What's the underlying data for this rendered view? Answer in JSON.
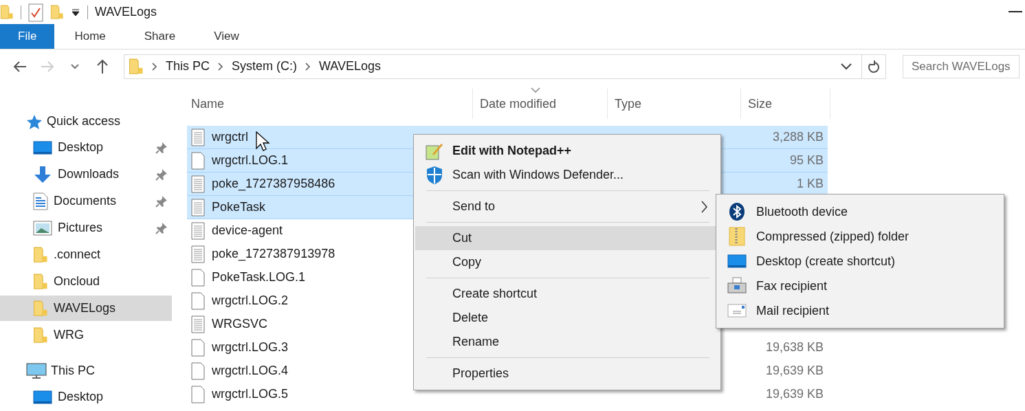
{
  "window": {
    "title": "WAVELogs"
  },
  "ribbon_tabs": [
    {
      "label": "File",
      "selected": true
    },
    {
      "label": "Home",
      "selected": false
    },
    {
      "label": "Share",
      "selected": false
    },
    {
      "label": "View",
      "selected": false
    }
  ],
  "address": {
    "path": [
      "This PC",
      "System (C:)",
      "WAVELogs"
    ]
  },
  "search": {
    "placeholder": "Search WAVELogs"
  },
  "sidebar": {
    "sections": [
      {
        "label": "Quick access",
        "kind": "star",
        "items": [
          {
            "label": "Desktop",
            "kind": "desktop",
            "pinned": true,
            "selected": false
          },
          {
            "label": "Downloads",
            "kind": "download",
            "pinned": true,
            "selected": false
          },
          {
            "label": "Documents",
            "kind": "document",
            "pinned": true,
            "selected": false
          },
          {
            "label": "Pictures",
            "kind": "pictures",
            "pinned": true,
            "selected": false
          },
          {
            "label": ".connect",
            "kind": "folder",
            "pinned": false,
            "selected": false
          },
          {
            "label": "Oncloud",
            "kind": "folder",
            "pinned": false,
            "selected": false
          },
          {
            "label": "WAVELogs",
            "kind": "folder",
            "pinned": false,
            "selected": true
          },
          {
            "label": "WRG",
            "kind": "folder",
            "pinned": false,
            "selected": false
          }
        ]
      },
      {
        "label": "This PC",
        "kind": "pc",
        "items": [
          {
            "label": "Desktop",
            "kind": "desktop",
            "pinned": false,
            "selected": false
          }
        ]
      }
    ]
  },
  "file_list": {
    "columns": [
      {
        "label": "Name",
        "sorted": false
      },
      {
        "label": "Date modified",
        "sorted": true
      },
      {
        "label": "Type",
        "sorted": false
      },
      {
        "label": "Size",
        "sorted": false
      }
    ],
    "rows": [
      {
        "name": "wrgctrl",
        "kind": "text",
        "selected": true,
        "size": "3,288 KB"
      },
      {
        "name": "wrgctrl.LOG.1",
        "kind": "blank",
        "selected": true,
        "size": "95 KB"
      },
      {
        "name": "poke_1727387958486",
        "kind": "text",
        "selected": true,
        "size": "1 KB"
      },
      {
        "name": "PokeTask",
        "kind": "text",
        "selected": true
      },
      {
        "name": "device-agent",
        "kind": "text",
        "selected": false
      },
      {
        "name": "poke_1727387913978",
        "kind": "text",
        "selected": false
      },
      {
        "name": "PokeTask.LOG.1",
        "kind": "blank",
        "selected": false
      },
      {
        "name": "wrgctrl.LOG.2",
        "kind": "blank",
        "selected": false
      },
      {
        "name": "WRGSVC",
        "kind": "text",
        "selected": false
      },
      {
        "name": "wrgctrl.LOG.3",
        "kind": "blank",
        "selected": false,
        "size": "19,638 KB"
      },
      {
        "name": "wrgctrl.LOG.4",
        "kind": "blank",
        "selected": false,
        "size": "19,639 KB"
      },
      {
        "name": "wrgctrl.LOG.5",
        "kind": "blank",
        "selected": false,
        "size": "19,639 KB"
      }
    ]
  },
  "context_menu": {
    "items": [
      {
        "kind": "item",
        "label": "Edit with Notepad++",
        "bold": true,
        "highlighted": false
      },
      {
        "kind": "item",
        "label": "Scan with Windows Defender...",
        "bold": false,
        "highlighted": false
      },
      {
        "kind": "separator"
      },
      {
        "kind": "submenu",
        "label": "Send to",
        "bold": false,
        "highlighted": false,
        "expanded": true
      },
      {
        "kind": "separator"
      },
      {
        "kind": "item",
        "label": "Cut",
        "bold": false,
        "highlighted": true
      },
      {
        "kind": "item",
        "label": "Copy",
        "bold": false,
        "highlighted": false
      },
      {
        "kind": "separator"
      },
      {
        "kind": "item",
        "label": "Create shortcut",
        "bold": false,
        "highlighted": false
      },
      {
        "kind": "item",
        "label": "Delete",
        "bold": false,
        "highlighted": false
      },
      {
        "kind": "item",
        "label": "Rename",
        "bold": false,
        "highlighted": false
      },
      {
        "kind": "separator"
      },
      {
        "kind": "item",
        "label": "Properties",
        "bold": false,
        "highlighted": false
      }
    ]
  },
  "send_to_menu": {
    "items": [
      {
        "label": "Bluetooth device",
        "kind": "bluetooth"
      },
      {
        "label": "Compressed (zipped) folder",
        "kind": "zip"
      },
      {
        "label": "Desktop (create shortcut)",
        "kind": "desktop"
      },
      {
        "label": "Fax recipient",
        "kind": "fax"
      },
      {
        "label": "Mail recipient",
        "kind": "mail"
      }
    ]
  }
}
